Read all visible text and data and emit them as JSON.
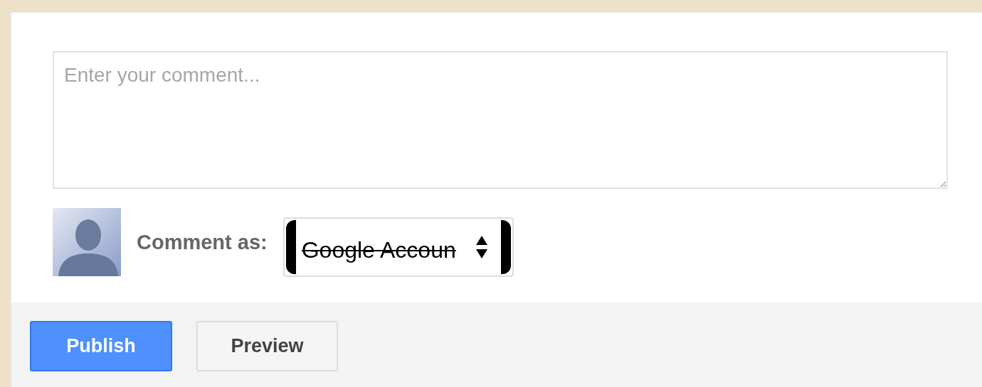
{
  "comment": {
    "placeholder": "Enter your comment..."
  },
  "comment_as": {
    "label": "Comment as:",
    "value": "Google Accoun"
  },
  "buttons": [
    {
      "label": "Publish",
      "kind": "primary"
    },
    {
      "label": "Preview",
      "kind": "secondary"
    }
  ]
}
